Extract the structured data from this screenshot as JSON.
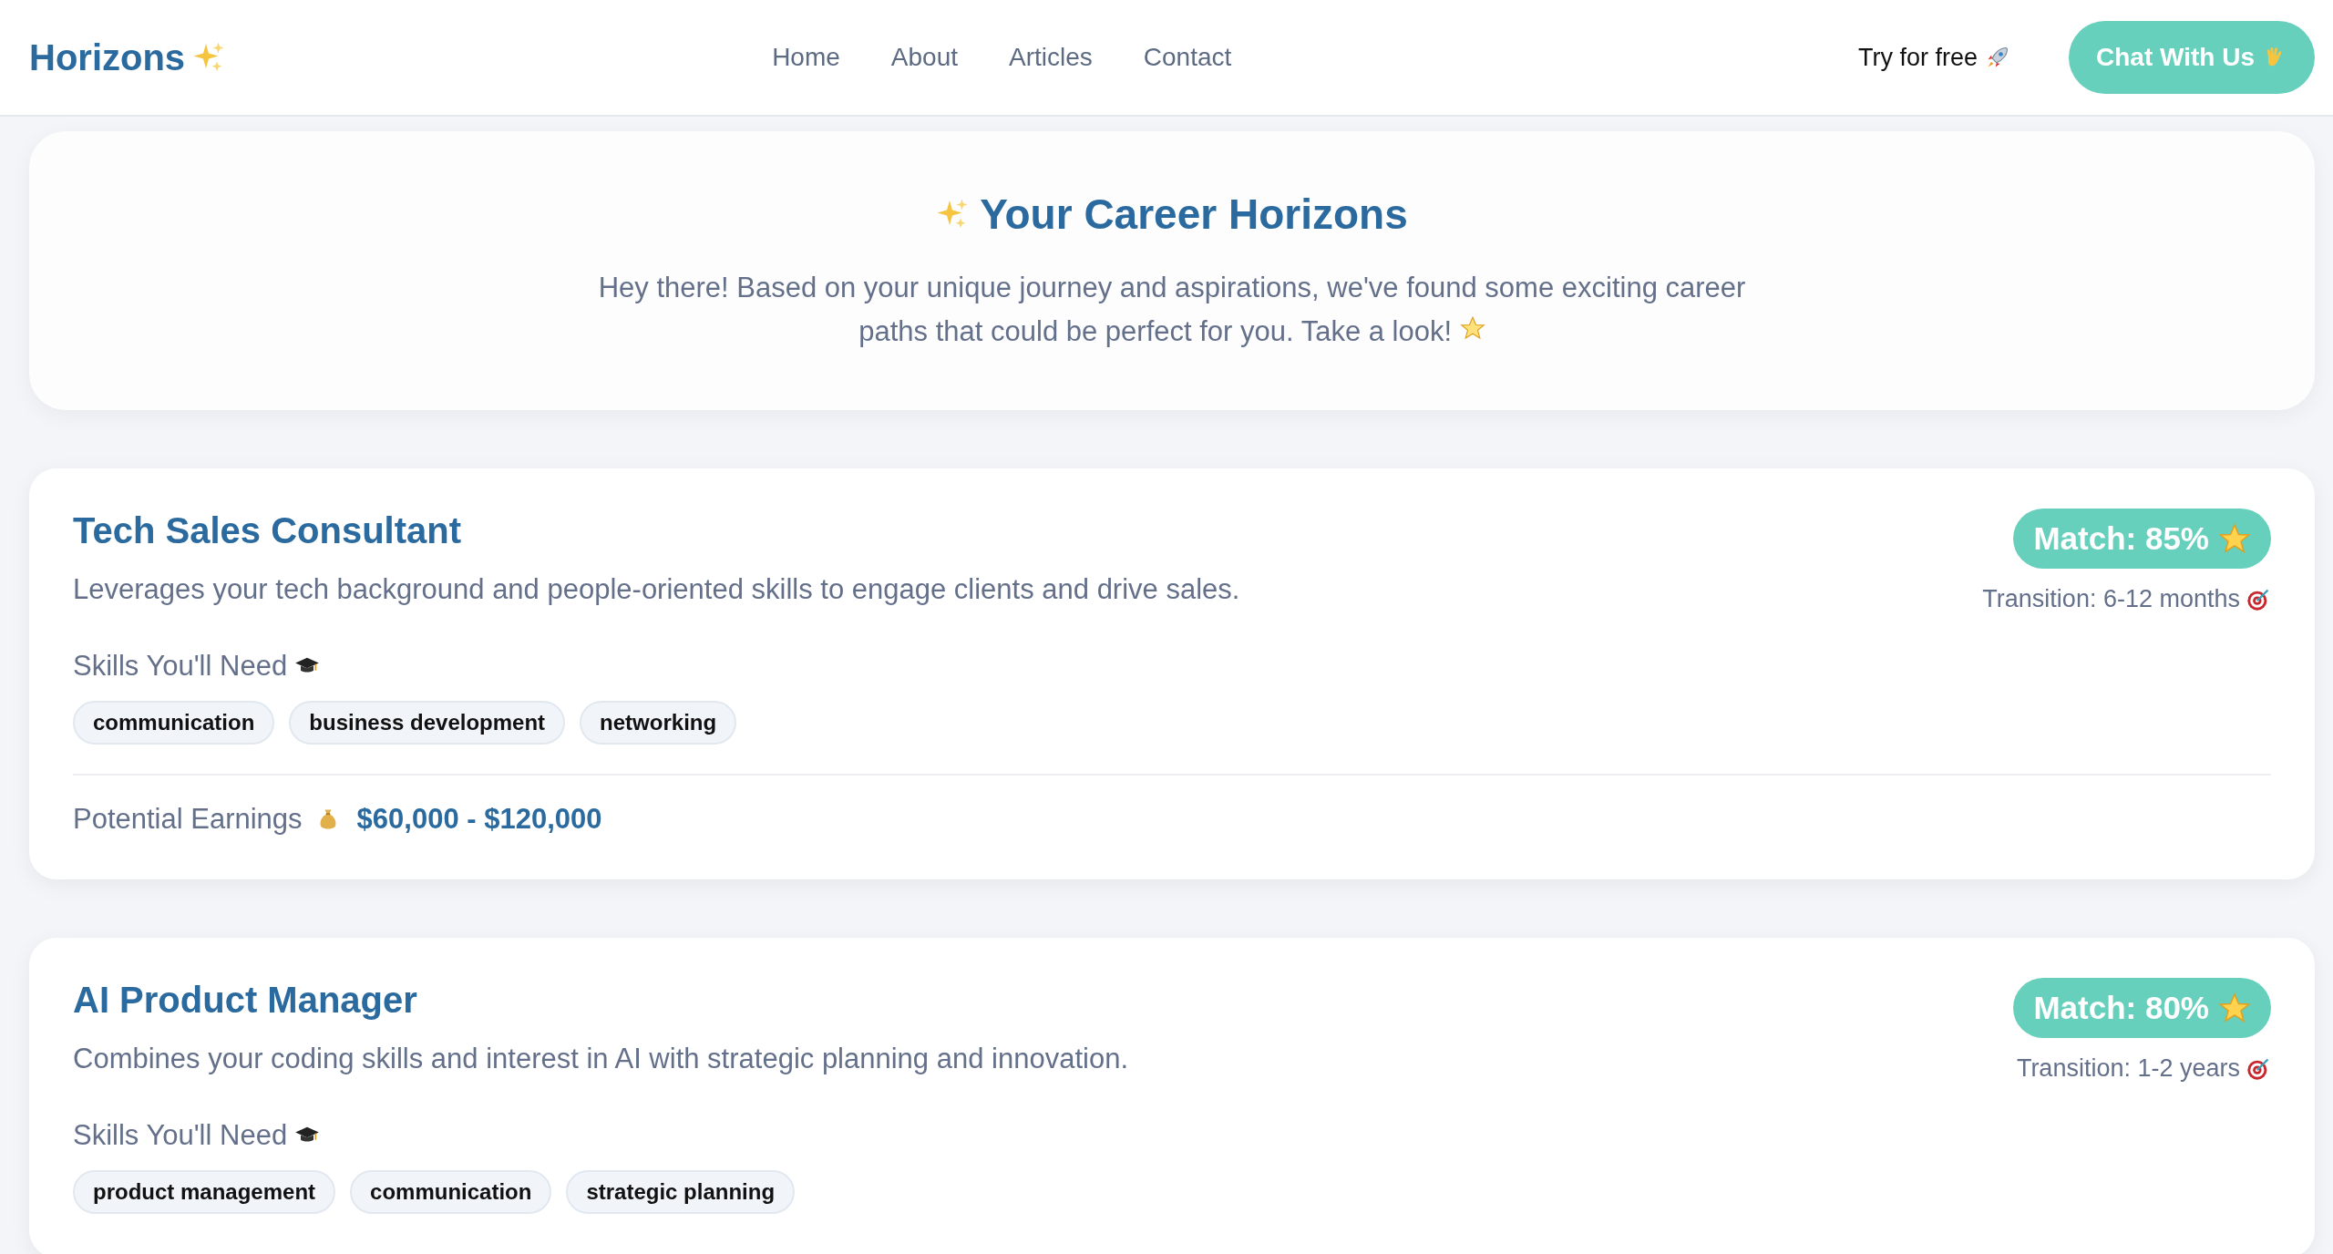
{
  "header": {
    "logo": "Horizons",
    "nav": [
      {
        "label": "Home"
      },
      {
        "label": "About"
      },
      {
        "label": "Articles"
      },
      {
        "label": "Contact"
      }
    ],
    "try_link": "Try for free",
    "chat_button": "Chat With Us"
  },
  "hero": {
    "title": "Your Career Horizons",
    "text": "Hey there! Based on your unique journey and aspirations, we've found some exciting career paths that could be perfect for you. Take a look!"
  },
  "careers": [
    {
      "title": "Tech Sales Consultant",
      "description": "Leverages your tech background and people-oriented skills to engage clients and drive sales.",
      "match": "Match: 85%",
      "transition": "Transition: 6-12 months",
      "skills_label": "Skills You'll Need",
      "skills": [
        "communication",
        "business development",
        "networking"
      ],
      "earnings_label": "Potential Earnings",
      "earnings": "$60,000 - $120,000"
    },
    {
      "title": "AI Product Manager",
      "description": "Combines your coding skills and interest in AI with strategic planning and innovation.",
      "match": "Match: 80%",
      "transition": "Transition: 1-2 years",
      "skills_label": "Skills You'll Need",
      "skills": [
        "product management",
        "communication",
        "strategic planning"
      ]
    }
  ]
}
